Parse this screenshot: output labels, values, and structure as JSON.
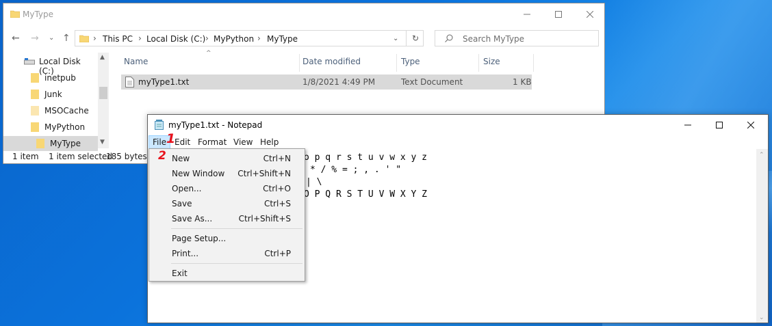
{
  "explorer": {
    "title": "MyType",
    "breadcrumbs": [
      "This PC",
      "Local Disk (C:)",
      "MyPython",
      "MyType"
    ],
    "search_placeholder": "Search MyType",
    "nav_items": [
      {
        "label": "Local Disk (C:)",
        "icon": "drive-icon"
      },
      {
        "label": "inetpub",
        "icon": "folder-icon"
      },
      {
        "label": "Junk",
        "icon": "folder-icon"
      },
      {
        "label": "MSOCache",
        "icon": "folder-icon"
      },
      {
        "label": "MyPython",
        "icon": "folder-icon"
      },
      {
        "label": "MyType",
        "icon": "folder-icon",
        "selected": true
      }
    ],
    "columns": [
      "Name",
      "Date modified",
      "Type",
      "Size"
    ],
    "files": [
      {
        "name": "myType1.txt",
        "date": "1/8/2021 4:49 PM",
        "type": "Text Document",
        "size": "1 KB"
      }
    ],
    "status": {
      "count": "1 item",
      "selected": "1 item selected",
      "size": "185 bytes"
    }
  },
  "notepad": {
    "title": "myType1.txt - Notepad",
    "menus": [
      "File",
      "Edit",
      "Format",
      "View",
      "Help"
    ],
    "text_lines": [
      "o p q r s t u v w x y z",
      "* / % = ; , . ' \"",
      "| \\",
      "O P Q R S T U V W X Y Z"
    ]
  },
  "file_menu": {
    "items": [
      {
        "label": "New",
        "shortcut": "Ctrl+N"
      },
      {
        "label": "New Window",
        "shortcut": "Ctrl+Shift+N"
      },
      {
        "label": "Open...",
        "shortcut": "Ctrl+O"
      },
      {
        "label": "Save",
        "shortcut": "Ctrl+S"
      },
      {
        "label": "Save As...",
        "shortcut": "Ctrl+Shift+S"
      },
      {
        "label": "Page Setup...",
        "shortcut": ""
      },
      {
        "label": "Print...",
        "shortcut": "Ctrl+P"
      },
      {
        "label": "Exit",
        "shortcut": ""
      }
    ]
  },
  "annotations": {
    "step1": "1",
    "step2": "2"
  },
  "colors": {
    "accent": "#cce8ff",
    "annotation": "#e8121c",
    "desktop": "#0b73dc",
    "selection": "#d9d9d9"
  }
}
